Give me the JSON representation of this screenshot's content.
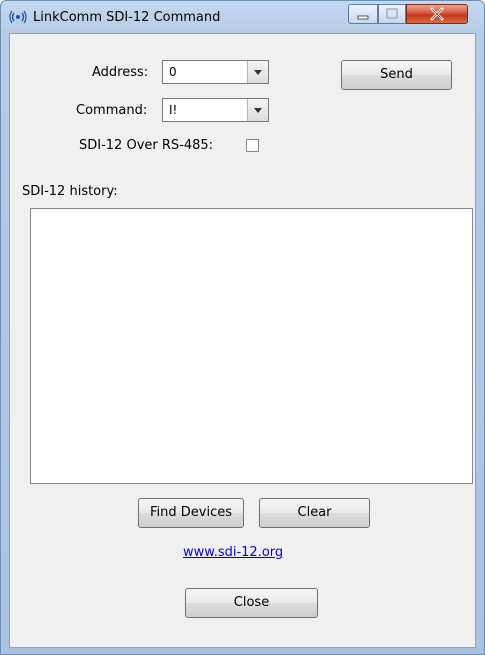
{
  "window": {
    "title": "LinkComm SDI-12 Command",
    "icon": "antenna-icon"
  },
  "form": {
    "address_label": "Address:",
    "address_value": "0",
    "command_label": "Command:",
    "command_value": "I!",
    "rs485_label": "SDI-12 Over RS-485:",
    "rs485_checked": false,
    "send_label": "Send"
  },
  "history": {
    "label": "SDI-12 history:",
    "content": ""
  },
  "footer": {
    "find_devices_label": "Find Devices",
    "clear_label": "Clear",
    "link_text": "www.sdi-12.org",
    "close_label": "Close"
  },
  "colors": {
    "titlebar": "#a9c2e0",
    "client_bg": "#f0f0f0",
    "link": "#0000ee",
    "close_button": "#c3361b"
  }
}
